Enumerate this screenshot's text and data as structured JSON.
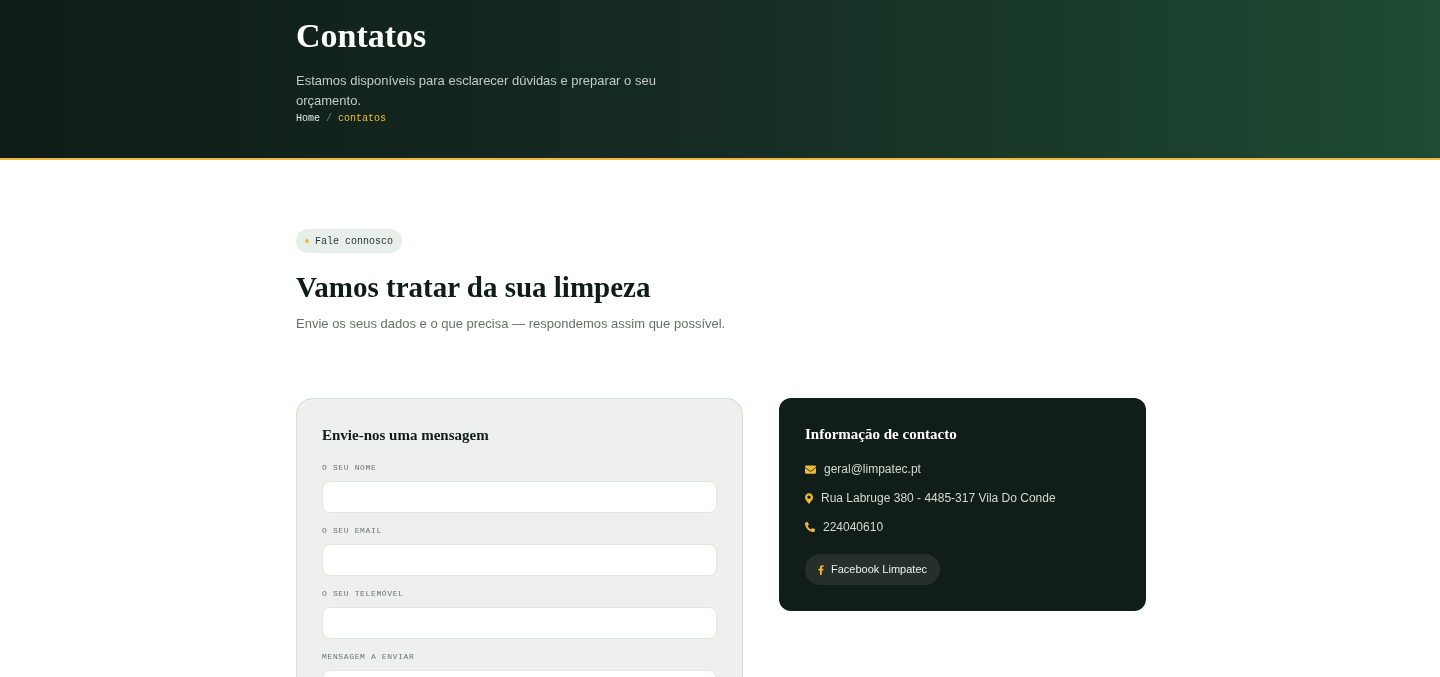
{
  "header": {
    "title": "Contatos",
    "subtitle": "Estamos disponíveis para esclarecer dúvidas e preparar o seu orçamento.",
    "breadcrumb": [
      {
        "label": "Home",
        "selected": false
      },
      {
        "label": "contatos",
        "selected": true
      }
    ],
    "breadcrumb_separator": "/"
  },
  "intro": {
    "badge": "Fale connosco",
    "title": "Vamos tratar da sua limpeza",
    "subtitle": "Envie os seus dados e o que precisa — respondemos assim que possível."
  },
  "form": {
    "title": "Envie-nos uma mensagem",
    "fields": [
      {
        "label": "O SEU NOME",
        "kind": "input"
      },
      {
        "label": "O SEU EMAIL",
        "kind": "input"
      },
      {
        "label": "O SEU TELEMÓVEL",
        "kind": "input"
      },
      {
        "label": "MENSAGEM A ENVIAR",
        "kind": "textarea"
      }
    ]
  },
  "contact": {
    "title": "Informação de contacto",
    "items": [
      {
        "kind": "email",
        "text": "geral@limpatec.pt"
      },
      {
        "kind": "address",
        "text": "Rua Labruge 380 - 4485-317 Vila Do Conde"
      },
      {
        "kind": "phone",
        "text": "224040610"
      }
    ],
    "social_button": "Facebook Limpatec"
  }
}
